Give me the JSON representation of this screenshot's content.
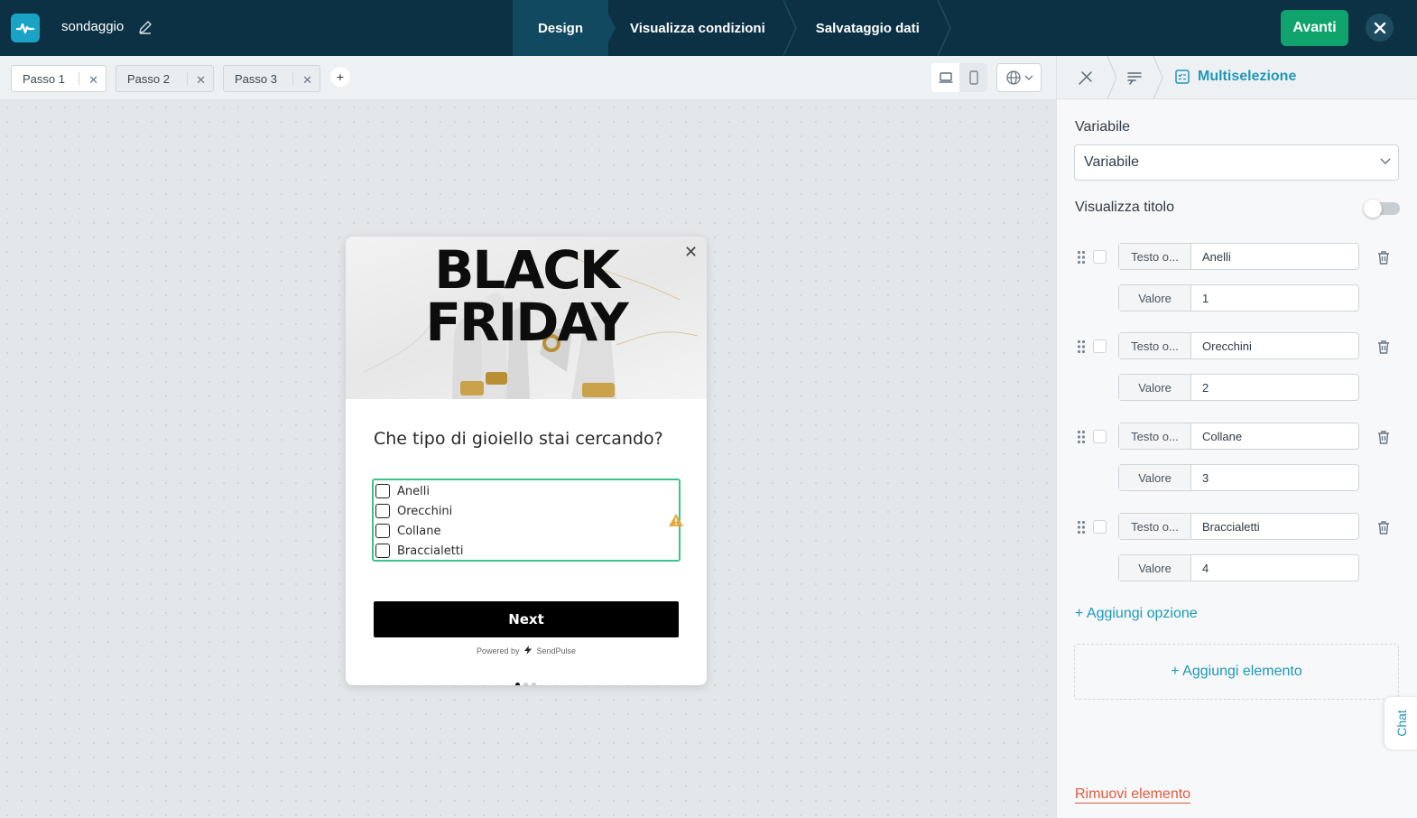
{
  "header": {
    "project_name": "sondaggio",
    "steps": [
      "Design",
      "Visualizza condizioni",
      "Salvataggio dati"
    ],
    "next_label": "Avanti"
  },
  "tabs": [
    "Passo 1",
    "Passo 2",
    "Passo 3"
  ],
  "add_tab_label": "+",
  "popup": {
    "hero_line1": "BLACK",
    "hero_line2": "FRIDAY",
    "question": "Che tipo di gioiello stai cercando?",
    "options": [
      "Anelli",
      "Orecchini",
      "Collane",
      "Braccialetti"
    ],
    "button_label": "Next",
    "powered_prefix": "Powered by",
    "powered_brand": "SendPulse"
  },
  "panel": {
    "breadcrumb_active": "Multiselezione",
    "variable_label": "Variabile",
    "variable_value": "Variabile",
    "show_title_label": "Visualizza titolo",
    "show_title_on": false,
    "text_key": "Testo o...",
    "value_key": "Valore",
    "options": [
      {
        "text": "Anelli",
        "value": "1"
      },
      {
        "text": "Orecchini",
        "value": "2"
      },
      {
        "text": "Collane",
        "value": "3"
      },
      {
        "text": "Braccialetti",
        "value": "4"
      }
    ],
    "add_option": "+ Aggiungi opzione",
    "add_element": "+ Aggiungi elemento",
    "chat": "Chat",
    "remove_element": "Rimuovi elemento"
  },
  "colors": {
    "header_bg": "#0c3144",
    "accent": "#1e98b7",
    "primary_button": "#10a36b",
    "danger": "#e05a3c",
    "option_border": "#3cc38d"
  }
}
